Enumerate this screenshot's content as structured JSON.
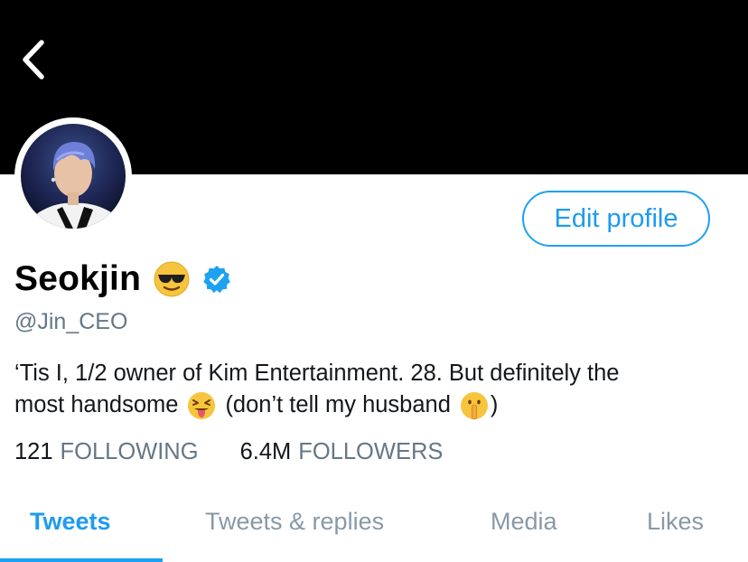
{
  "profile": {
    "display_name": "Seokjin",
    "name_emoji": "smiling-face-with-sunglasses",
    "verified": true,
    "handle": "@Jin_CEO",
    "bio_line1": "‘Tis I, 1/2 owner of Kim Entertainment. 28. But definitely the",
    "bio_line2_a": "most handsome",
    "bio_line2_b": "(don’t tell my husband",
    "bio_line2_c": ")",
    "bio_emojis": [
      "squinting-face-with-tongue",
      "shushing-face"
    ]
  },
  "header": {
    "back_icon": "chevron-left-icon",
    "banner_color": "#000000"
  },
  "actions": {
    "edit_profile_label": "Edit profile"
  },
  "stats": {
    "following_count": "121",
    "following_label": "FOLLOWING",
    "followers_count": "6.4M",
    "followers_label": "FOLLOWERS"
  },
  "tabs": [
    {
      "label": "Tweets",
      "active": true
    },
    {
      "label": "Tweets & replies",
      "active": false
    },
    {
      "label": "Media",
      "active": false
    },
    {
      "label": "Likes",
      "active": false
    }
  ],
  "colors": {
    "accent": "#1da1f2",
    "secondary_text": "#657786",
    "verified_badge": "#1da1f2"
  }
}
